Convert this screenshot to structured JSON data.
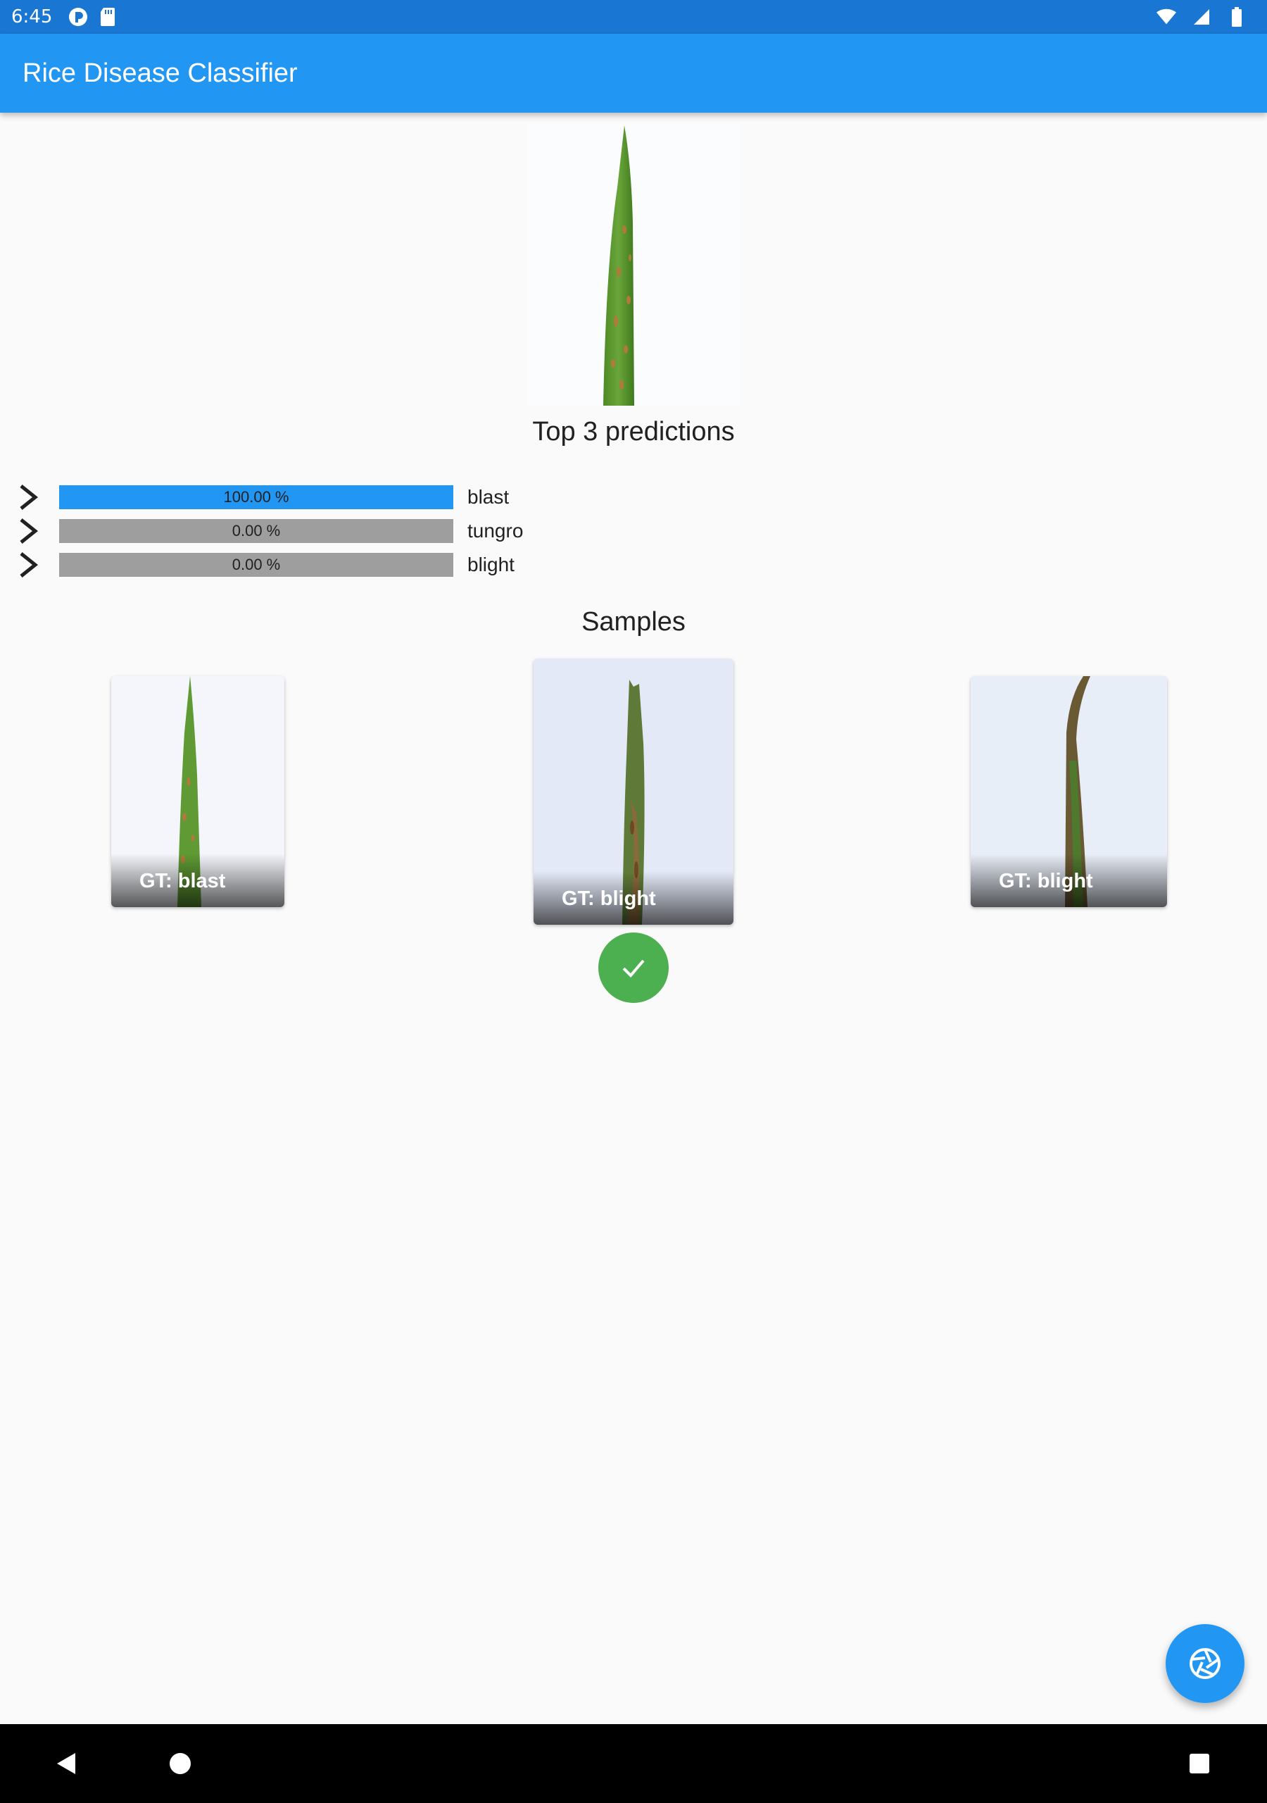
{
  "status_bar": {
    "time": "6:45",
    "icons_left": [
      "play-protect-icon",
      "sd-card-icon"
    ],
    "icons_right": [
      "wifi-icon",
      "signal-icon",
      "battery-icon"
    ]
  },
  "app_bar": {
    "title": "Rice Disease Classifier",
    "color": "#2196f3"
  },
  "predictions": {
    "title": "Top 3 predictions",
    "items": [
      {
        "label": "blast",
        "value_text": "100.00 %",
        "value": 100.0,
        "color": "#2196f3"
      },
      {
        "label": "tungro",
        "value_text": "0.00 %",
        "value": 0.0,
        "color": "#2196f3"
      },
      {
        "label": "blight",
        "value_text": "0.00 %",
        "value": 0.0,
        "color": "#2196f3"
      }
    ],
    "track_color": "#9e9e9e"
  },
  "samples": {
    "title": "Samples",
    "items": [
      {
        "caption": "GT: blast",
        "selected": false
      },
      {
        "caption": "GT: blight",
        "selected": true
      },
      {
        "caption": "GT: blight",
        "selected": false
      }
    ],
    "selected_indicator": "check-icon",
    "indicator_color": "#4caf50"
  },
  "fab": {
    "icon": "camera-shutter-icon"
  },
  "nav_bar": {
    "icons": [
      "back-icon",
      "home-icon",
      "recents-icon"
    ]
  }
}
